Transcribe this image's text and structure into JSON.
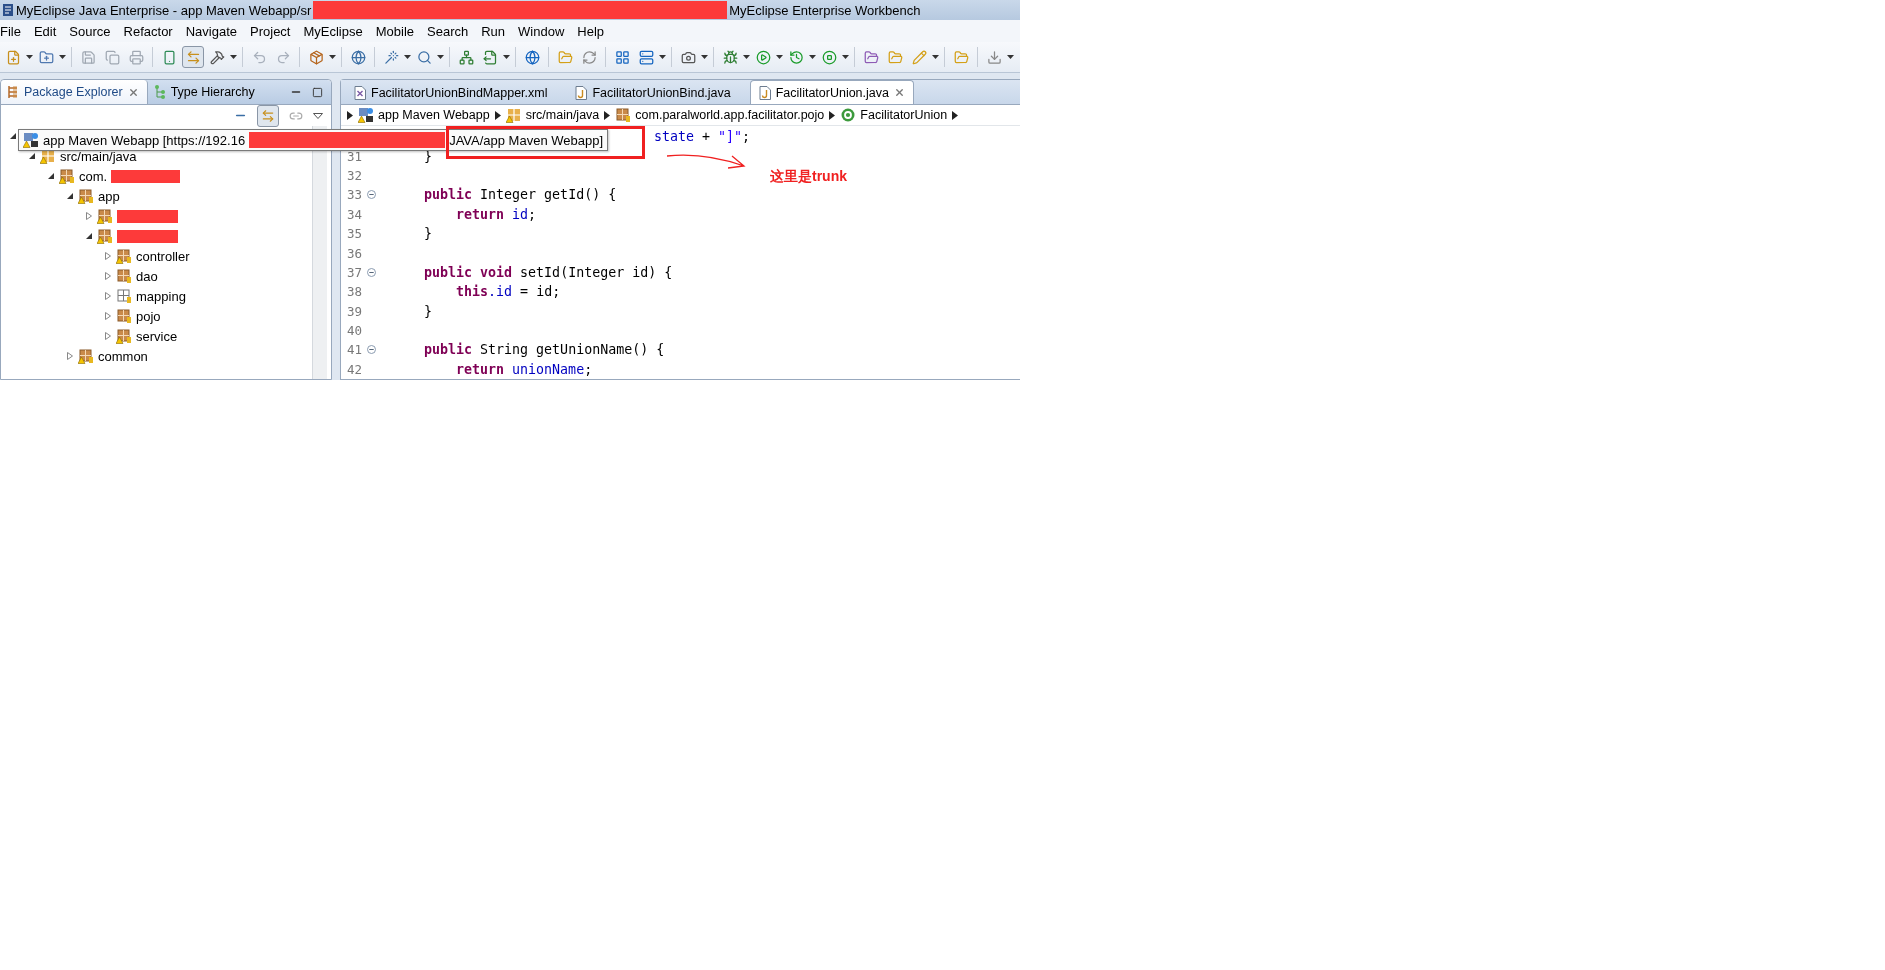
{
  "window": {
    "title_start": "MyEclipse Java Enterprise - app Maven Webapp/sr",
    "title_end": "MyEclipse Enterprise Workbench",
    "redacted": true
  },
  "menu": [
    "File",
    "Edit",
    "Source",
    "Refactor",
    "Navigate",
    "Project",
    "MyEclipse",
    "Mobile",
    "Search",
    "Run",
    "Window",
    "Help"
  ],
  "left_panel": {
    "tabs": [
      {
        "label": "Package Explorer",
        "selected": true
      },
      {
        "label": "Type Hierarchy",
        "selected": false
      }
    ],
    "tree": [
      {
        "expanded": true,
        "children": [
          {
            "label": "src/main/java",
            "kind": "source_folder",
            "warning": true,
            "expanded": true,
            "children": [
              {
                "label": "com.",
                "kind": "package",
                "warning": true,
                "redacted": true,
                "expanded": true,
                "children": [
                  {
                    "label": "app",
                    "kind": "package",
                    "warning": true,
                    "expanded": true,
                    "children": [
                      {
                        "kind": "package",
                        "warning": true,
                        "redacted": true,
                        "expanded": false
                      },
                      {
                        "kind": "package",
                        "warning": true,
                        "redacted": true,
                        "expanded": true,
                        "children": [
                          {
                            "label": "controller",
                            "kind": "package",
                            "warning": true,
                            "expanded": false
                          },
                          {
                            "label": "dao",
                            "kind": "package",
                            "warning": false,
                            "expanded": false
                          },
                          {
                            "label": "mapping",
                            "kind": "empty_package",
                            "warning": false,
                            "expanded": false
                          },
                          {
                            "label": "pojo",
                            "kind": "package",
                            "warning": false,
                            "expanded": false
                          },
                          {
                            "label": "service",
                            "kind": "package",
                            "warning": true,
                            "expanded": false
                          }
                        ]
                      }
                    ]
                  },
                  {
                    "label": "common",
                    "kind": "package",
                    "warning": true,
                    "expanded": false
                  }
                ]
              }
            ]
          }
        ]
      }
    ]
  },
  "tooltip": {
    "text_start": "app Maven Webapp [https://192.16",
    "text_end": "JAVA/app Maven Webapp]",
    "redacted": true
  },
  "editor": {
    "tabs": [
      {
        "label": "FacilitatorUnionBindMapper.xml",
        "kind": "xml",
        "selected": false
      },
      {
        "label": "FacilitatorUnionBind.java",
        "kind": "java",
        "selected": false
      },
      {
        "label": "FacilitatorUnion.java",
        "kind": "java",
        "selected": true
      }
    ],
    "breadcrumb": [
      {
        "label": "app Maven Webapp",
        "kind": "project"
      },
      {
        "label": "src/main/java",
        "kind": "source_folder"
      },
      {
        "label": "com.paralworld.app.facilitator.pojo",
        "kind": "package"
      },
      {
        "label": "FacilitatorUnion",
        "kind": "class"
      }
    ],
    "lines": [
      {
        "kind": "partial",
        "tokens": [
          {
            "t": "state",
            "kind": "field"
          },
          {
            "t": " + ",
            "kind": "plain"
          },
          {
            "t": "\"]\"",
            "kind": "string"
          },
          {
            "t": ";",
            "kind": "plain"
          }
        ]
      },
      {
        "kind": "code",
        "number": "31",
        "fold": false,
        "tokens": [
          {
            "t": "    }",
            "kind": "plain"
          }
        ]
      },
      {
        "kind": "code",
        "number": "32",
        "fold": false
      },
      {
        "kind": "code",
        "number": "33",
        "fold": true,
        "tokens": [
          {
            "t": "    public",
            "kind": "keyword"
          },
          {
            "t": " Integer getId() {",
            "kind": "plain"
          }
        ]
      },
      {
        "kind": "code",
        "number": "34",
        "fold": false,
        "tokens": [
          {
            "t": "        return",
            "kind": "keyword"
          },
          {
            "t": " id",
            "kind": "field"
          },
          {
            "t": ";",
            "kind": "plain"
          }
        ]
      },
      {
        "kind": "code",
        "number": "35",
        "fold": false,
        "tokens": [
          {
            "t": "    }",
            "kind": "plain"
          }
        ]
      },
      {
        "kind": "code",
        "number": "36",
        "fold": false
      },
      {
        "kind": "code",
        "number": "37",
        "fold": true,
        "tokens": [
          {
            "t": "    public",
            "kind": "keyword"
          },
          {
            "t": " void",
            "kind": "keyword"
          },
          {
            "t": " setId(Integer id) {",
            "kind": "plain"
          }
        ]
      },
      {
        "kind": "code",
        "number": "38",
        "fold": false,
        "tokens": [
          {
            "t": "        this",
            "kind": "keyword"
          },
          {
            "t": ".id",
            "kind": "field"
          },
          {
            "t": " = id;",
            "kind": "plain"
          }
        ]
      },
      {
        "kind": "code",
        "number": "39",
        "fold": false,
        "tokens": [
          {
            "t": "    }",
            "kind": "plain"
          }
        ]
      },
      {
        "kind": "code",
        "number": "40",
        "fold": false
      },
      {
        "kind": "code",
        "number": "41",
        "fold": true,
        "tokens": [
          {
            "t": "    public",
            "kind": "keyword"
          },
          {
            "t": " String getUnionName() {",
            "kind": "plain"
          }
        ]
      },
      {
        "kind": "code",
        "number": "42",
        "fold": false,
        "tokens": [
          {
            "t": "        return",
            "kind": "keyword"
          },
          {
            "t": " unionName",
            "kind": "field"
          },
          {
            "t": ";",
            "kind": "plain"
          }
        ]
      }
    ]
  },
  "annotation": {
    "note": "这里是trunk"
  }
}
